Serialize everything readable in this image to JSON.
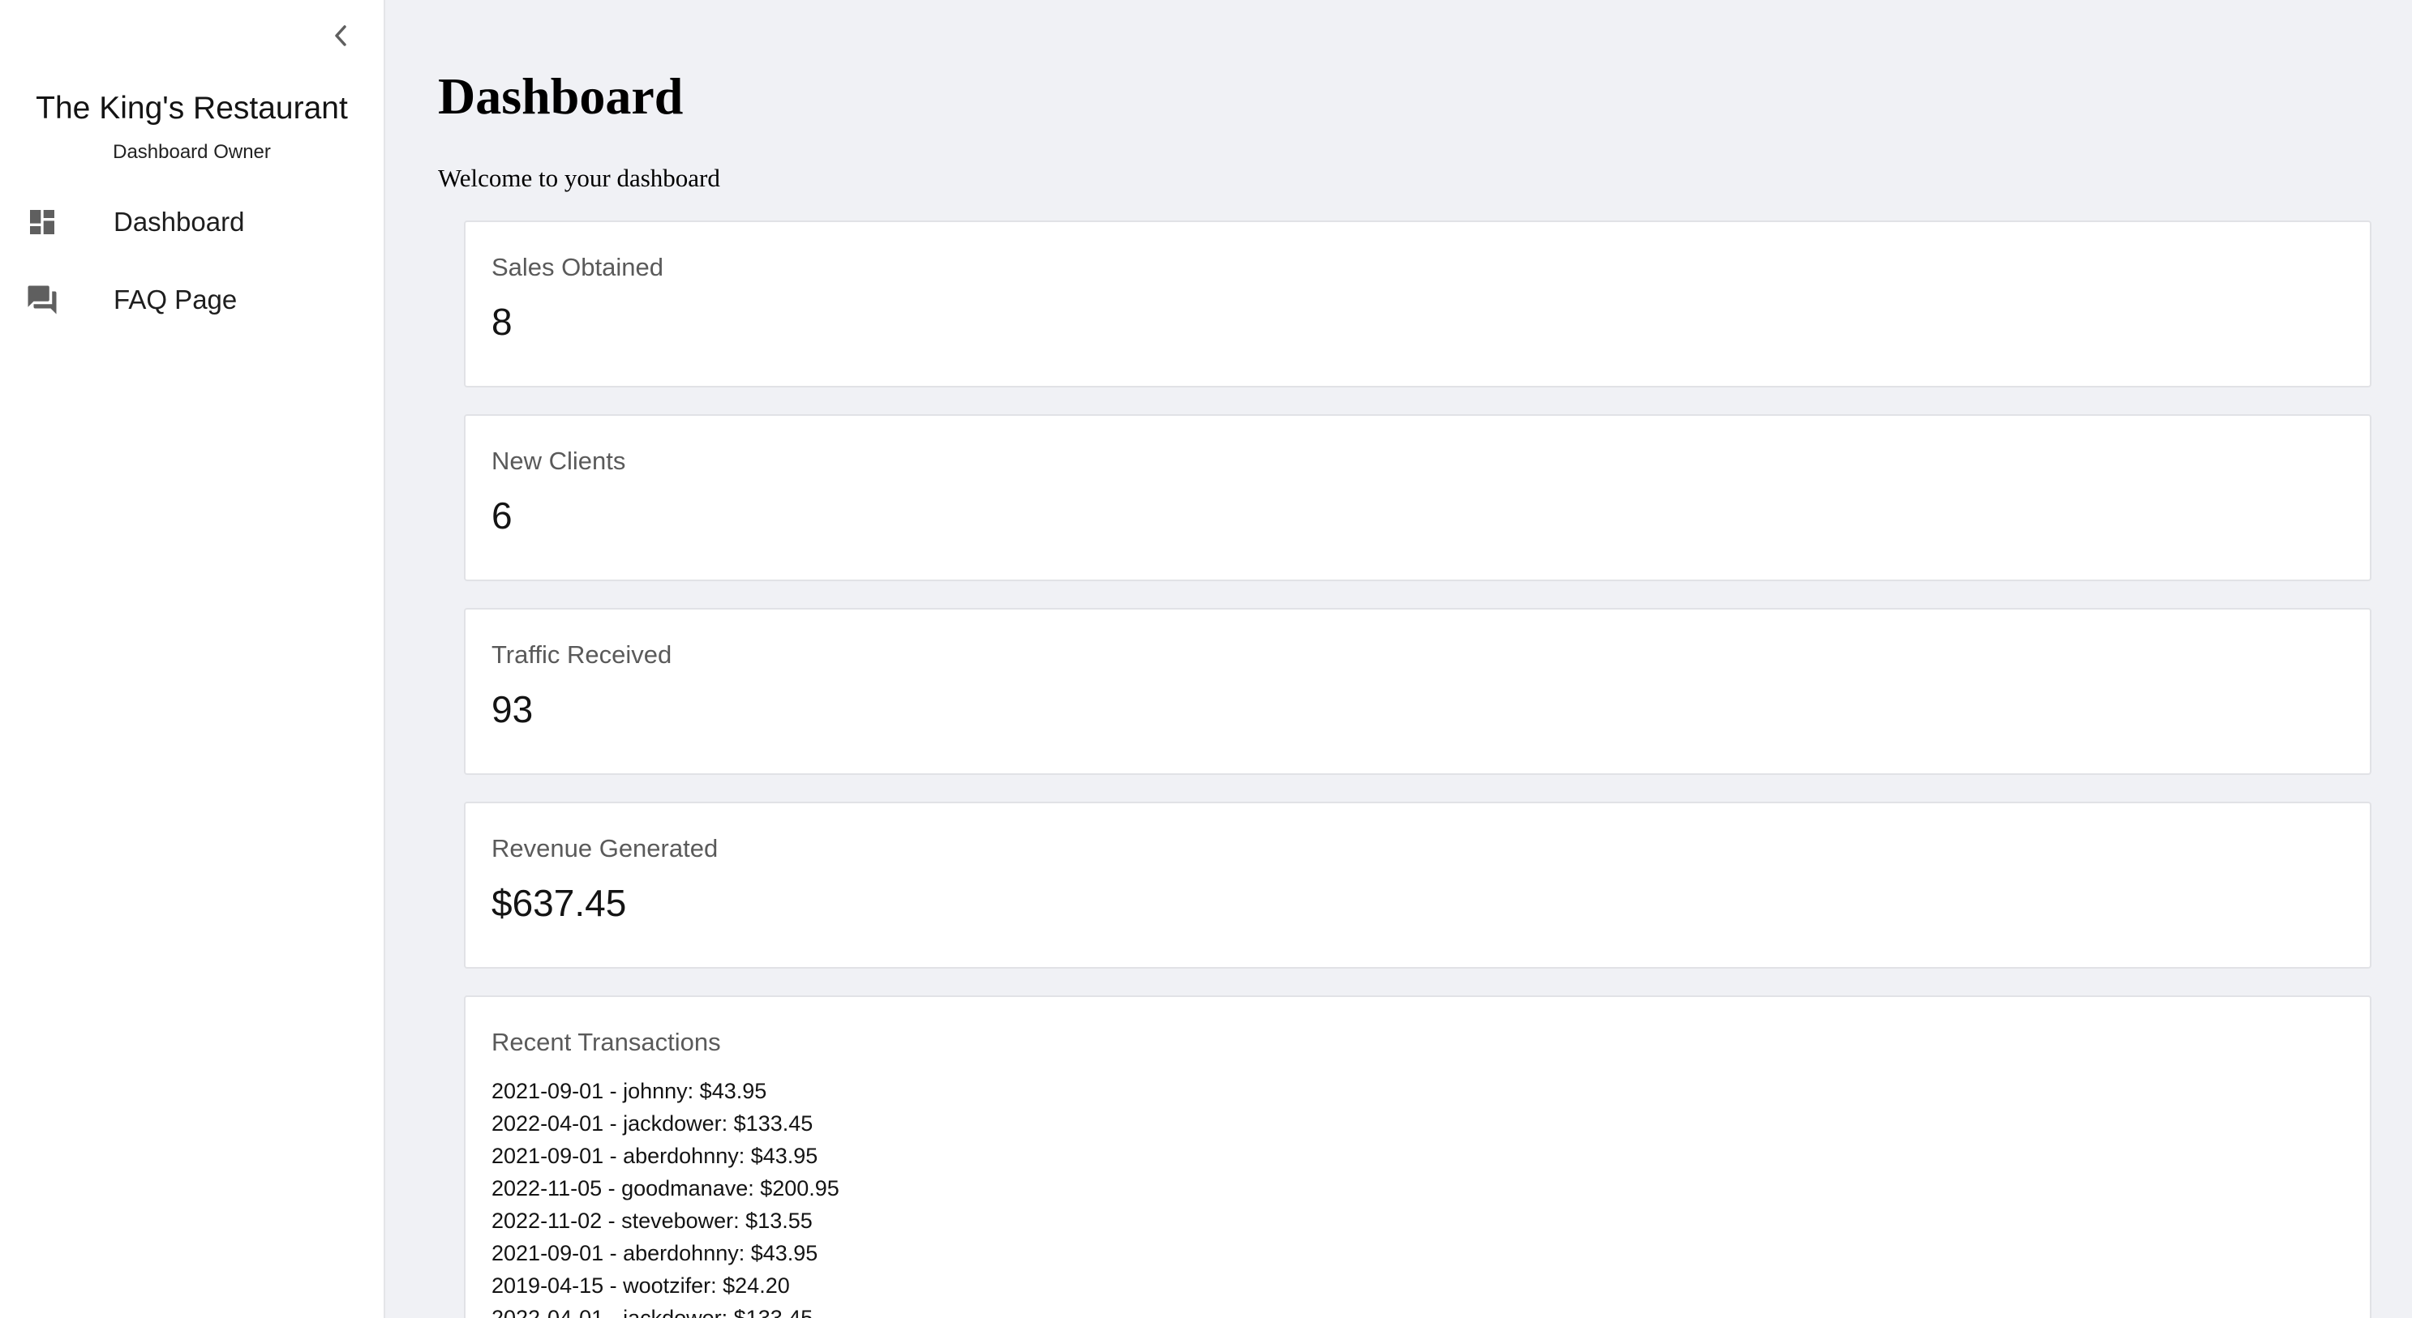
{
  "sidebar": {
    "brand_title": "The King's Restaurant",
    "brand_subtitle": "Dashboard Owner",
    "collapse_icon": "chevron-left-icon",
    "items": [
      {
        "label": "Dashboard",
        "icon": "dashboard-icon"
      },
      {
        "label": "FAQ Page",
        "icon": "forum-icon"
      }
    ]
  },
  "main": {
    "title": "Dashboard",
    "subtitle": "Welcome to your dashboard",
    "stats": [
      {
        "label": "Sales Obtained",
        "value": "8"
      },
      {
        "label": "New Clients",
        "value": "6"
      },
      {
        "label": "Traffic Received",
        "value": "93"
      },
      {
        "label": "Revenue Generated",
        "value": "$637.45"
      }
    ],
    "transactions": {
      "label": "Recent Transactions",
      "items": [
        "2021-09-01 - johnny: $43.95",
        "2022-04-01 - jackdower: $133.45",
        "2021-09-01 - aberdohnny: $43.95",
        "2022-11-05 - goodmanave: $200.95",
        "2022-11-02 - stevebower: $13.55",
        "2021-09-01 - aberdohnny: $43.95",
        "2019-04-15 - wootzifer: $24.20",
        "2022-04-01 - jackdower: $133.45"
      ]
    }
  },
  "colors": {
    "background": "#f0f1f5",
    "card": "#ffffff",
    "icon": "#5f5f5f"
  }
}
